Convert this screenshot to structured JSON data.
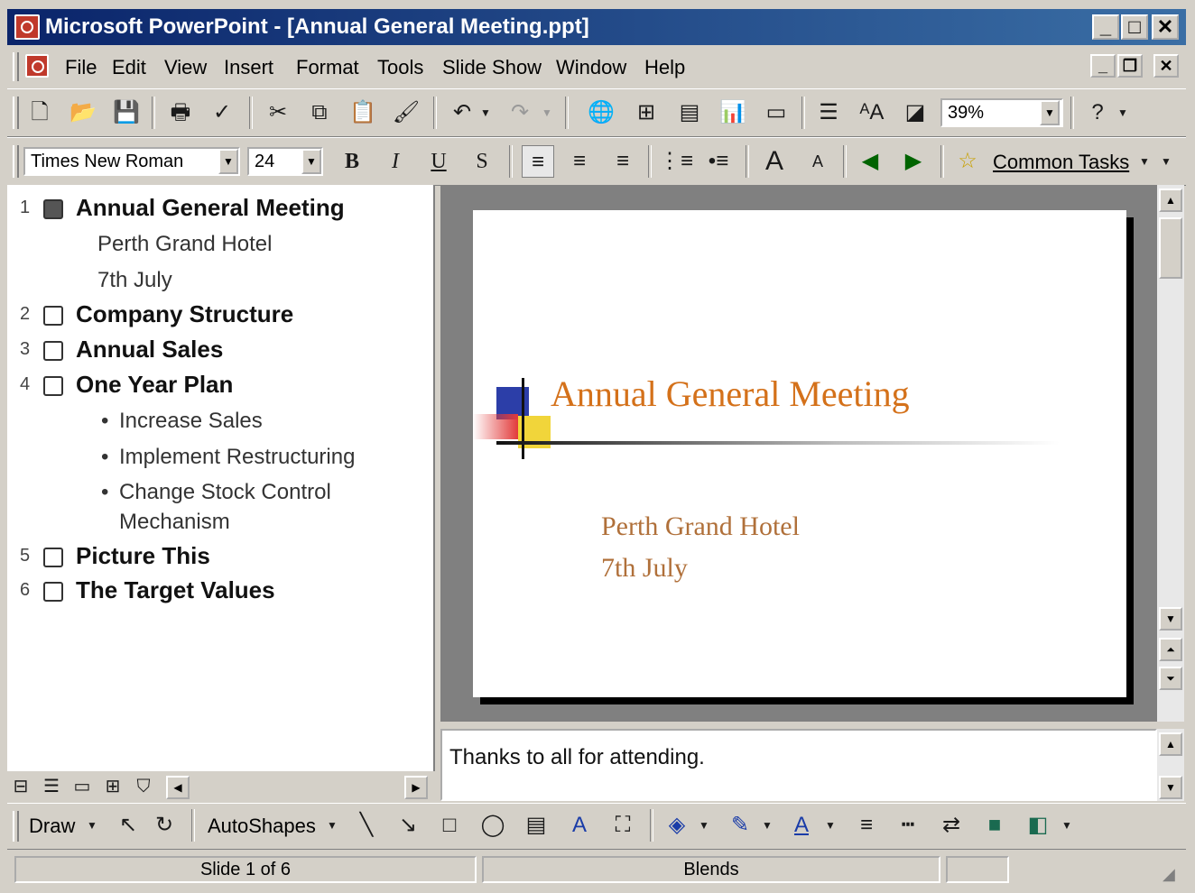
{
  "window": {
    "title": "Microsoft PowerPoint - [Annual General Meeting.ppt]"
  },
  "menu": {
    "items": [
      "File",
      "Edit",
      "View",
      "Insert",
      "Format",
      "Tools",
      "Slide Show",
      "Window",
      "Help"
    ]
  },
  "standard_toolbar": {
    "zoom": "39%"
  },
  "formatting_toolbar": {
    "font": "Times New Roman",
    "size": "24",
    "common_tasks": "Common Tasks"
  },
  "outline": {
    "slides": [
      {
        "num": "1",
        "title": "Annual General Meeting",
        "lines": [
          "Perth Grand Hotel",
          "7th July"
        ]
      },
      {
        "num": "2",
        "title": "Company Structure"
      },
      {
        "num": "3",
        "title": "Annual Sales"
      },
      {
        "num": "4",
        "title": "One Year Plan",
        "bullets": [
          "Increase Sales",
          "Implement Restructuring",
          "Change Stock Control",
          "Mechanism"
        ]
      },
      {
        "num": "5",
        "title": "Picture This"
      },
      {
        "num": "6",
        "title": "The Target Values"
      }
    ]
  },
  "slide": {
    "title": "Annual General Meeting",
    "subtitle_line1": "Perth Grand Hotel",
    "subtitle_line2": "7th July",
    "title_color": "#d4711a",
    "subtitle_color": "#b0703a"
  },
  "notes": {
    "text": "Thanks to all for attending."
  },
  "drawing_toolbar": {
    "draw": "Draw",
    "autoshapes": "AutoShapes"
  },
  "status": {
    "slide": "Slide 1 of 6",
    "design": "Blends"
  }
}
